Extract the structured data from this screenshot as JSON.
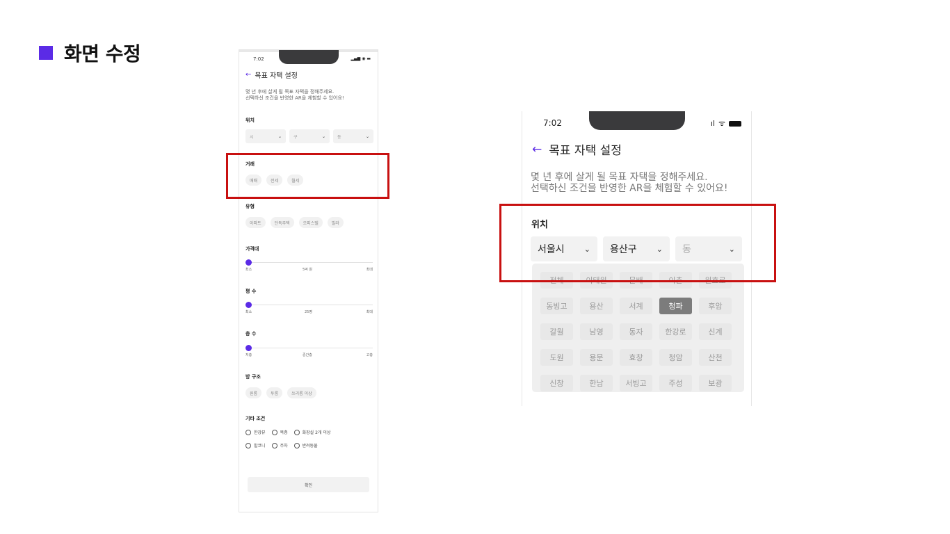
{
  "slide": {
    "title": "화면 수정"
  },
  "phone_small": {
    "time": "7:02",
    "status": "▂▄▆ ◉ ▬",
    "back_icon": "←",
    "title": "목표 자택 설정",
    "desc_line1": "몇 년 후에 살게 될 목표 자택을 정해주세요.",
    "desc_line2": "선택하신 조건을 반영한 AR을 체험할 수 있어요!",
    "location": {
      "label": "위치",
      "selects": [
        {
          "value": "시"
        },
        {
          "value": "구"
        },
        {
          "value": "동"
        }
      ],
      "chevron": "⌄"
    },
    "trade": {
      "label": "거래",
      "chips": [
        "매매",
        "전세",
        "월세"
      ]
    },
    "type": {
      "label": "유형",
      "chips": [
        "아파트",
        "단독주택",
        "오피스텔",
        "빌라"
      ]
    },
    "price": {
      "label": "가격대",
      "min": "최소",
      "mid": "5억 원",
      "max": "최대",
      "level": 0
    },
    "area": {
      "label": "평 수",
      "min": "최소",
      "mid": "25평",
      "max": "최대",
      "level": 0
    },
    "floor": {
      "label": "층 수",
      "min": "저층",
      "mid": "중간층",
      "max": "고층",
      "level": 0
    },
    "rooms": {
      "label": "방 구조",
      "chips": [
        "원룸",
        "투룸",
        "쓰리룸 이상"
      ]
    },
    "extra": {
      "label": "기타 조건",
      "row1": [
        "한강뷰",
        "복층",
        "화장실 2개 이상"
      ],
      "row2": [
        "발코니",
        "주차",
        "반려동물"
      ]
    },
    "confirm": "확인"
  },
  "phone_large": {
    "time": "7:02",
    "signal": "ıl",
    "wifi": "ᯤ",
    "back_icon": "←",
    "title": "목표 자택 설정",
    "desc_line1": "몇 년 후에 살게 될 목표 자택을 정해주세요.",
    "desc_line2": "선택하신 조건을 반영한 AR을 체험할 수 있어요!",
    "location": {
      "label": "위치",
      "city": "서울시",
      "district": "용산구",
      "dong_placeholder": "동",
      "chevron": "⌄"
    },
    "dong_grid": [
      "전체",
      "이태원",
      "문배",
      "이촌",
      "원효로",
      "동빙고",
      "용산",
      "서계",
      "청파",
      "후암",
      "갈월",
      "남영",
      "동자",
      "한강로",
      "신계",
      "도원",
      "용문",
      "효창",
      "청암",
      "산천",
      "신창",
      "한남",
      "서빙고",
      "주성",
      "보광"
    ],
    "selected_dong": "청파"
  },
  "colors": {
    "accent": "#5b2be6",
    "highlight": "#c81010",
    "selected_cell": "#7c7c7c"
  }
}
